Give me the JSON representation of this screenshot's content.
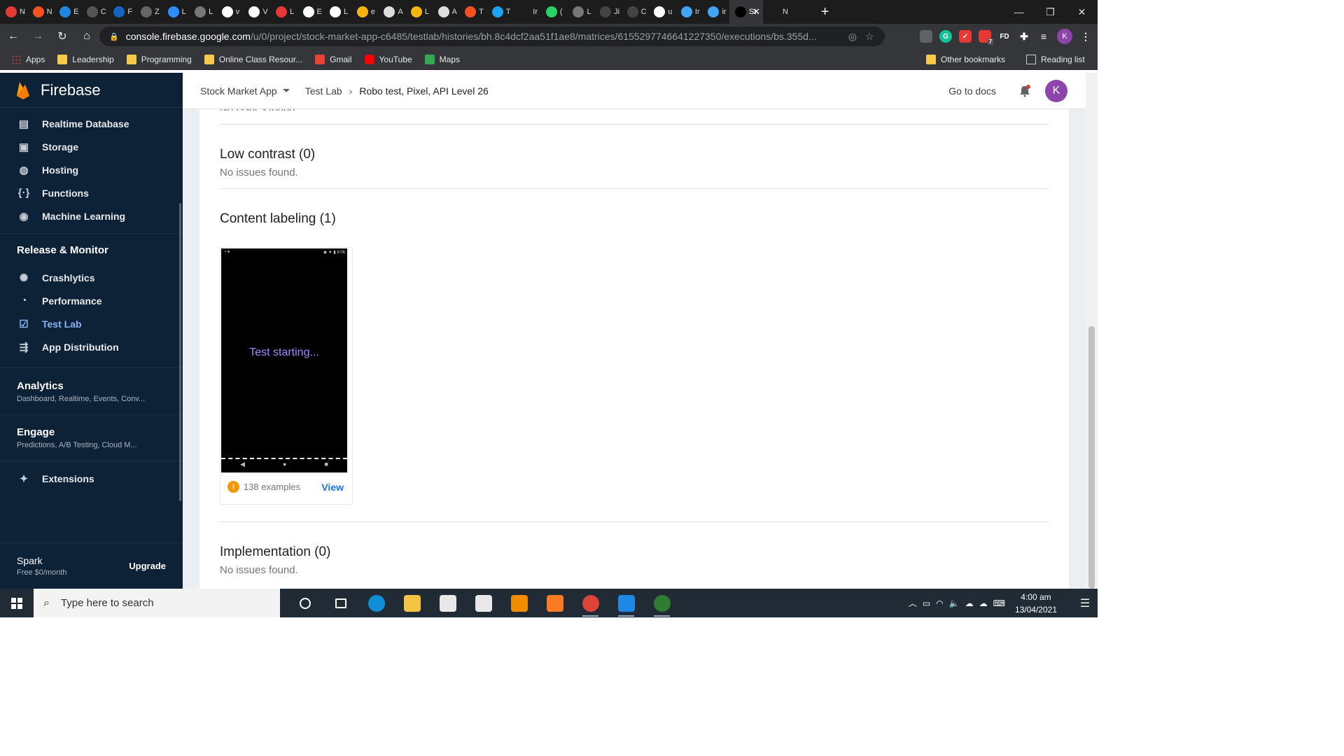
{
  "browser": {
    "tabs": [
      {
        "short": "N",
        "color": "#e53935"
      },
      {
        "short": "N",
        "color": "#f4511e"
      },
      {
        "short": "E",
        "color": "#1e88e5"
      },
      {
        "short": "C",
        "color": "#555555"
      },
      {
        "short": "F",
        "color": "#1565c0"
      },
      {
        "short": "Z",
        "color": "#666666"
      },
      {
        "short": "L",
        "color": "#2d8cff"
      },
      {
        "short": "L",
        "color": "#777777"
      },
      {
        "short": "v",
        "color": "#ffffff"
      },
      {
        "short": "V",
        "color": "#ffffff"
      },
      {
        "short": "L",
        "color": "#e53935"
      },
      {
        "short": "E",
        "color": "#ffffff"
      },
      {
        "short": "L",
        "color": "#ffffff"
      },
      {
        "short": "e",
        "color": "#f6b40e"
      },
      {
        "short": "A",
        "color": "#dddddd"
      },
      {
        "short": "L",
        "color": "#f6b40e"
      },
      {
        "short": "A",
        "color": "#dddddd"
      },
      {
        "short": "T",
        "color": "#f4511e"
      },
      {
        "short": "T",
        "color": "#1da1f2"
      },
      {
        "short": "Ir",
        "color": "#1c1c1c"
      },
      {
        "short": "(",
        "color": "#25d366"
      },
      {
        "short": "L",
        "color": "#777777"
      },
      {
        "short": "Ji",
        "color": "#444444"
      },
      {
        "short": "C",
        "color": "#444444"
      },
      {
        "short": "u",
        "color": "#ffffff"
      },
      {
        "short": "Ir",
        "color": "#42a5f5"
      },
      {
        "short": "ir",
        "color": "#42a5f5"
      },
      {
        "short": "St",
        "color": "#000000",
        "active": true
      },
      {
        "short": "N",
        "color": "#1c1c1c"
      }
    ],
    "new_tab": "+",
    "url_domain": "console.firebase.google.com",
    "url_path": "/u/0/project/stock-market-app-c6485/testlab/histories/bh.8c4dcf2aa51f1ae8/matrices/6155297746641227350/executions/bs.355d...",
    "profile_initial": "K",
    "ext_badge": "7",
    "ext_fd": "FD",
    "bookmarks": {
      "apps": "Apps",
      "items": [
        "Leadership",
        "Programming",
        "Online Class Resour...",
        "Gmail",
        "YouTube",
        "Maps"
      ],
      "other": "Other bookmarks",
      "reading": "Reading list"
    }
  },
  "firebase": {
    "brand": "Firebase",
    "build_items": [
      {
        "label": "Realtime Database",
        "icon": "database-icon"
      },
      {
        "label": "Storage",
        "icon": "storage-icon"
      },
      {
        "label": "Hosting",
        "icon": "hosting-icon"
      },
      {
        "label": "Functions",
        "icon": "functions-icon"
      },
      {
        "label": "Machine Learning",
        "icon": "robot-icon"
      }
    ],
    "release_title": "Release & Monitor",
    "release_items": [
      {
        "label": "Crashlytics",
        "icon": "crashlytics-icon"
      },
      {
        "label": "Performance",
        "icon": "performance-icon"
      },
      {
        "label": "Test Lab",
        "icon": "testlab-icon",
        "active": true
      },
      {
        "label": "App Distribution",
        "icon": "app-distribution-icon"
      }
    ],
    "analytics": {
      "title": "Analytics",
      "subtitle": "Dashboard, Realtime, Events, Conv..."
    },
    "engage": {
      "title": "Engage",
      "subtitle": "Predictions, A/B Testing, Cloud M..."
    },
    "extensions": "Extensions",
    "plan": {
      "name": "Spark",
      "price": "Free $0/month",
      "upgrade": "Upgrade"
    },
    "breadcrumb": {
      "project": "Stock Market App",
      "section": "Test Lab",
      "current": "Robo test, Pixel, API Level 26"
    },
    "docs": "Go to docs",
    "avatar": "K"
  },
  "content": {
    "top_partial": "No issues found.",
    "low_contrast": {
      "title": "Low contrast (0)",
      "status": "No issues found."
    },
    "content_labeling": {
      "title": "Content labeling (1)"
    },
    "thumbnail": {
      "status_bar": "8:06",
      "message": "Test starting...",
      "examples": "138 examples",
      "view": "View",
      "warn": "!"
    },
    "implementation": {
      "title": "Implementation (0)",
      "status": "No issues found."
    }
  },
  "taskbar": {
    "search_placeholder": "Type here to search",
    "time": "4:00 am",
    "date": "13/04/2021",
    "apps": [
      {
        "name": "task-view-icon",
        "color": "#202b36"
      },
      {
        "name": "task-switcher-icon",
        "color": "#202b36"
      },
      {
        "name": "edge-icon",
        "color": "#0f8fd6"
      },
      {
        "name": "file-explorer-icon",
        "color": "#f4c542"
      },
      {
        "name": "store-icon",
        "color": "#e8e8e8"
      },
      {
        "name": "mail-icon",
        "color": "#e8e8e8"
      },
      {
        "name": "vlc-icon",
        "color": "#f28c00"
      },
      {
        "name": "xampp-icon",
        "color": "#fb7a24"
      },
      {
        "name": "chrome-icon",
        "color": "#db4437"
      },
      {
        "name": "vscode-icon",
        "color": "#1e88e5"
      },
      {
        "name": "snip-icon",
        "color": "#2e7d32"
      }
    ]
  }
}
